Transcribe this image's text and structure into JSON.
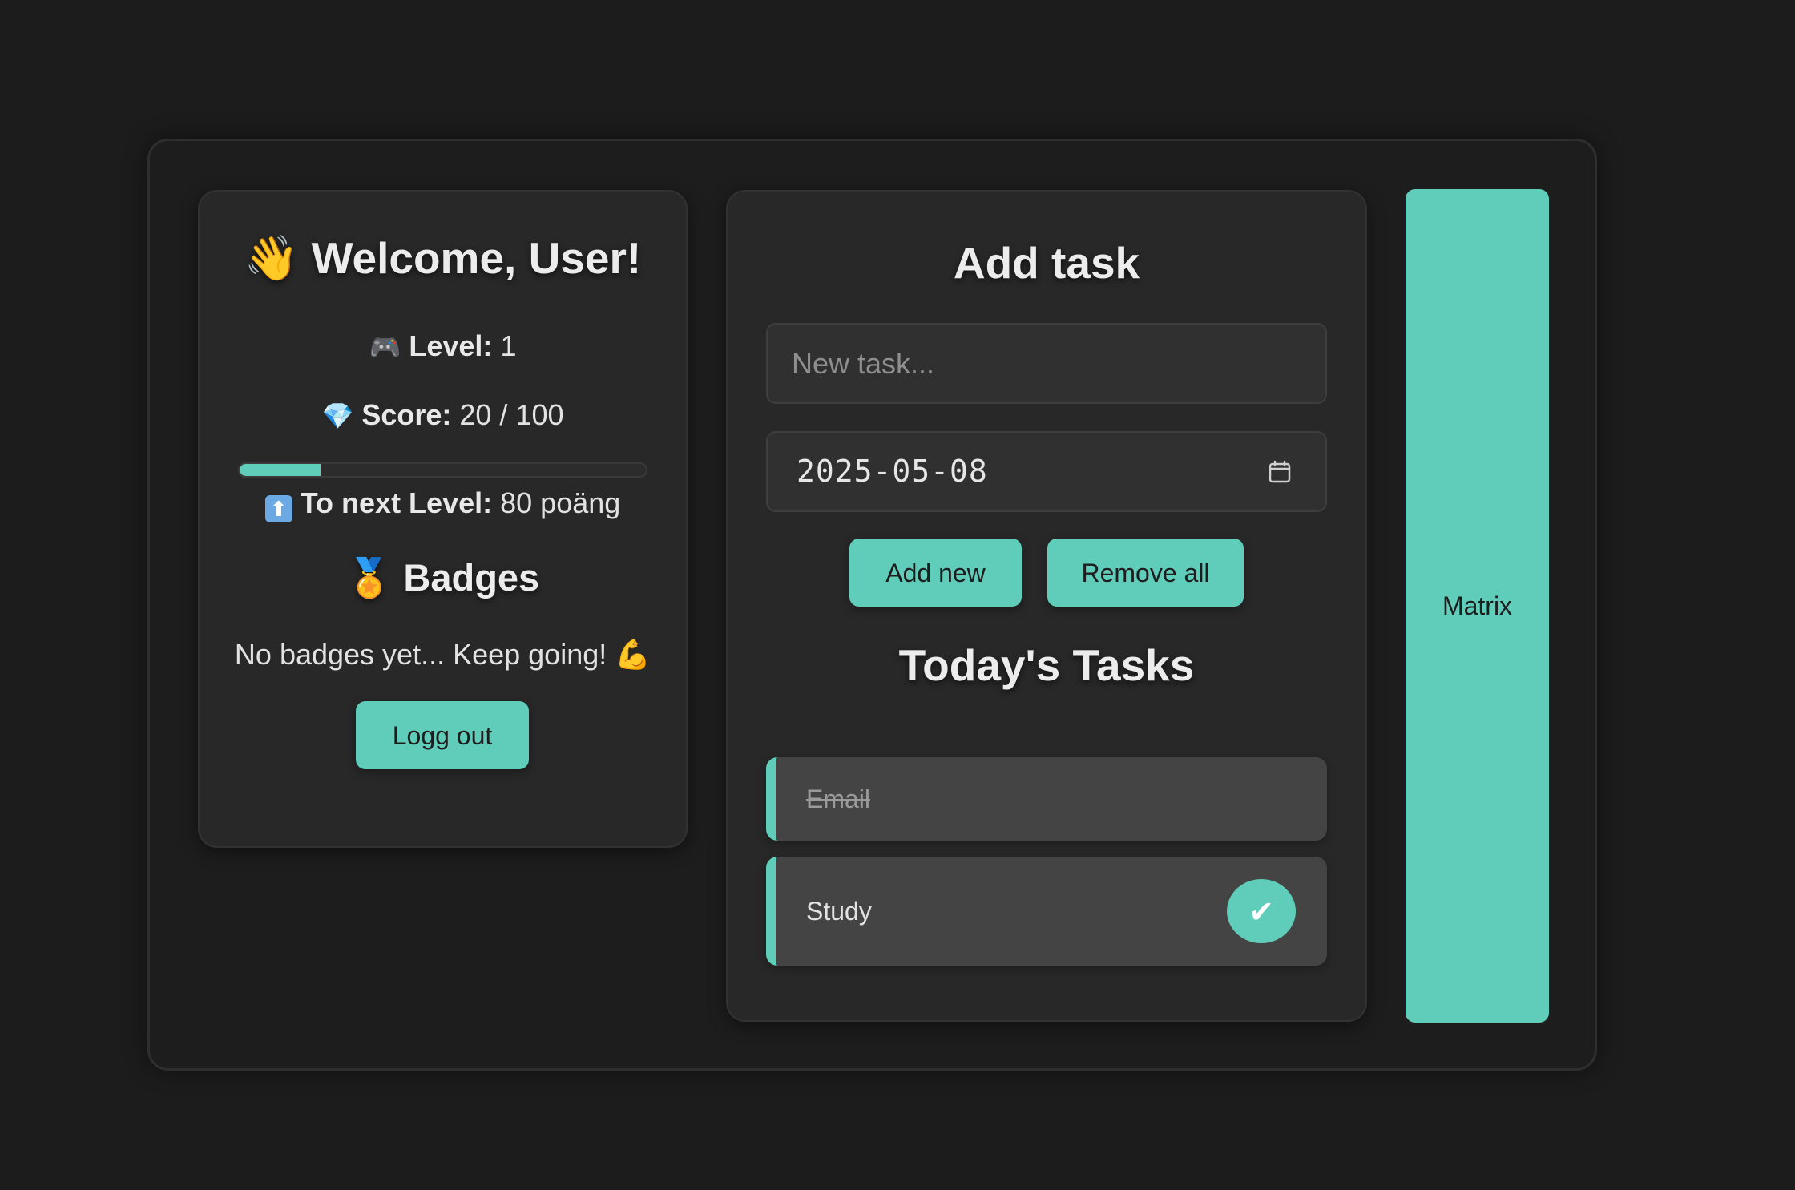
{
  "profile": {
    "welcome_emoji": "👋",
    "welcome_text": "Welcome, User!",
    "level_emoji": "🎮",
    "level_label": "Level:",
    "level_value": "1",
    "score_emoji": "💎",
    "score_label": "Score:",
    "score_value": "20 / 100",
    "progress_fraction": 0.2,
    "next_emoji": "⬆",
    "next_label": "To next Level:",
    "next_value": "80 poäng",
    "badges_emoji": "🏅",
    "badges_title": "Badges",
    "badges_empty": "No badges yet... Keep going! 💪",
    "logout_label": "Logg out"
  },
  "add_task": {
    "title": "Add task",
    "input_placeholder": "New task...",
    "input_value": "",
    "date_value": "2025-05-08",
    "calendar_icon": "calendar-icon",
    "add_label": "Add new",
    "remove_label": "Remove all"
  },
  "today": {
    "title": "Today's Tasks",
    "items": [
      {
        "label": "Email",
        "done": true
      },
      {
        "label": "Study",
        "done": false,
        "check_glyph": "✔"
      }
    ]
  },
  "matrix": {
    "label": "Matrix"
  },
  "colors": {
    "accent": "#5fcdb9",
    "background": "#1c1c1c",
    "card": "#282828"
  }
}
